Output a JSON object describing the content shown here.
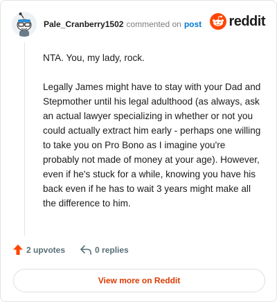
{
  "header": {
    "username": "Pale_Cranberry1502",
    "commented_text": "commented on",
    "post_link": "post",
    "brand": "reddit"
  },
  "comment": {
    "paragraphs": [
      "NTA. You, my lady, rock.",
      "Legally James might have to stay with your Dad and Stepmother until his legal adulthood (as always, ask an actual lawyer specializing in whether or not you could actually extract him early - perhaps one willing to take you on Pro Bono as I imagine you're probably not made of money at your age). However, even if he's stuck for a while, knowing you have his back even if he has to wait 3 years might make all the difference to him."
    ]
  },
  "actions": {
    "upvotes_label": "2 upvotes",
    "replies_label": "0 replies"
  },
  "footer": {
    "view_more_label": "View more on Reddit"
  },
  "colors": {
    "reddit_orange": "#ff4500",
    "link_blue": "#0079d3",
    "view_more_text": "#d93a00"
  },
  "icons": {
    "avatar": "snoo-avatar-icon",
    "brand": "reddit-snoo-icon",
    "upvote": "upvote-arrow-icon",
    "reply": "reply-arrow-icon"
  }
}
